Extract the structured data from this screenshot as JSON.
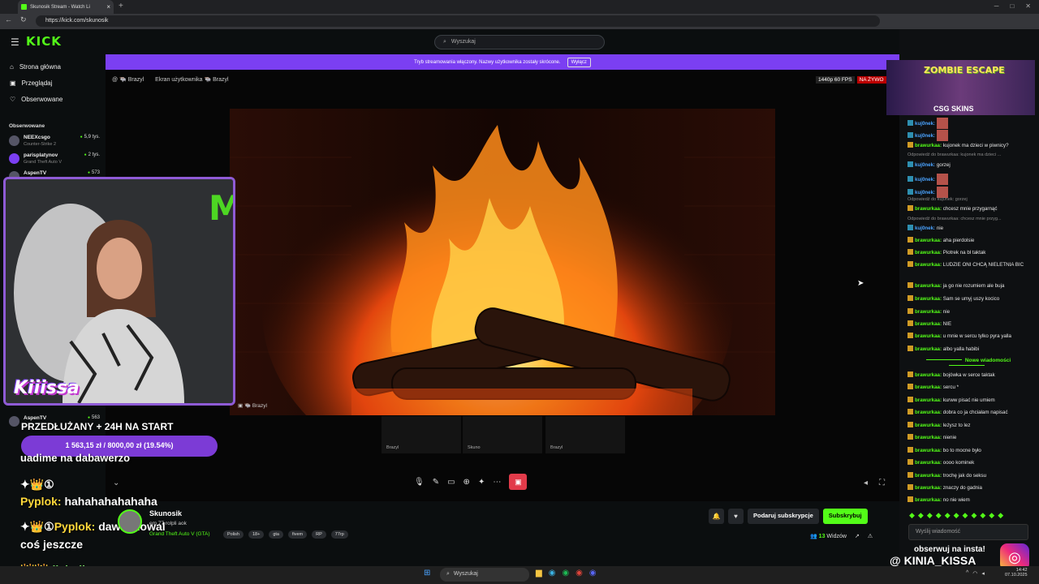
{
  "browser": {
    "tab_title": "Skunosik Stream - Watch Li",
    "url": "https://kick.com/skunosik"
  },
  "header": {
    "logo": "KICK",
    "search_placeholder": "Wyszukaj"
  },
  "sidebar": {
    "nav": [
      {
        "label": "Strona główna",
        "icon": "home-icon"
      },
      {
        "label": "Przeglądaj",
        "icon": "browse-icon"
      },
      {
        "label": "Obserwowane",
        "icon": "heart-icon"
      }
    ],
    "followed_header": "Obserwowane",
    "followed": [
      {
        "name": "NEEXcsgo",
        "game": "Counter-Strike 2",
        "viewers": "5,9 tys."
      },
      {
        "name": "parisplatynov",
        "game": "Grand Theft Auto V",
        "viewers": "2 tys."
      },
      {
        "name": "AspenTV",
        "game": "",
        "viewers": "573"
      },
      {
        "name": "AspenTV",
        "game": "",
        "viewers": "563"
      }
    ]
  },
  "banner": {
    "text": "Tryb streamowania włączony. Nazwy użytkownika zostały skrócone.",
    "button": "Wyłącz"
  },
  "player": {
    "source1": "Brazyl",
    "source2": "Ekran użytkownika",
    "source2_user": "Brazyl",
    "quality": "1440p 60 FPS",
    "live": "NA ŻYWO",
    "overlay_label": "Brazyl",
    "thumbs": [
      "Brazyl",
      "Skuno",
      "Brazyl"
    ]
  },
  "stream_overlay": {
    "goal_title": "PRZEDŁUŻANY + 24H NA START",
    "goal_amount": "1 563,15 zł / 8000,00 zł (19.54%)",
    "goal_progress": 0.1954,
    "cam_name": "Kiiissa",
    "chat_lines": [
      {
        "user": "",
        "text": "uadime na dabawerzo"
      },
      {
        "user": "Pyplok:",
        "text": "hahahahahahaha"
      },
      {
        "user": "Pyplok:",
        "text": "dawaj dowal"
      },
      {
        "user": "",
        "text": "coś jeszcze"
      },
      {
        "user": "diabolinanana:",
        "text": ""
      }
    ]
  },
  "channel": {
    "name": "Skunosik",
    "title": "em 77 rolpli aok",
    "game": "Grand Theft Auto V (GTA)",
    "tags": [
      "Polish",
      "18+",
      "gta",
      "fivem",
      "RP",
      "77rp"
    ],
    "gift_sub": "Podaruj subskrypcje",
    "subscribe": "Subskrybuj",
    "viewers_count": "13",
    "viewers_label": "Widzów"
  },
  "chat": {
    "ad_title": "ZOMBIE ESCAPE",
    "ad_brand": "CSG SKINS",
    "new_messages": "Nowe wiadomości",
    "input_placeholder": "Wyślij wiadomość",
    "messages": [
      {
        "user": "kuj0nek:",
        "text": "",
        "emote": true,
        "badge": "blue"
      },
      {
        "user": "kuj0nek:",
        "text": "",
        "emote": true,
        "badge": "blue"
      },
      {
        "user": "brawurkaa:",
        "text": "kujonek ma dzieci w piwnicy?",
        "badge": "gold"
      },
      {
        "reply": "Odpowiedź do brawurkaa: kujonek ma dzieci ..."
      },
      {
        "user": "kuj0nek:",
        "text": "gorzej",
        "badge": "blue"
      },
      {
        "user": "kuj0nek:",
        "text": "",
        "emote": true,
        "badge": "blue"
      },
      {
        "user": "kuj0nek:",
        "text": "",
        "emote": true,
        "badge": "blue"
      },
      {
        "reply": "Odpowiedź do kuj0nek: gorzej"
      },
      {
        "user": "brawurkaa:",
        "text": "chcesz mnie przygarnąć",
        "badge": "gold"
      },
      {
        "reply": "Odpowiedź do brawurkaa: chcesz mnie przyg..."
      },
      {
        "user": "kuj0nek:",
        "text": "nie",
        "badge": "blue"
      },
      {
        "user": "brawurkaa:",
        "text": "aha pierdolsie",
        "badge": "gold"
      },
      {
        "user": "brawurkaa:",
        "text": "Piotrek na bl taktak",
        "badge": "gold"
      },
      {
        "user": "brawurkaa:",
        "text": "LUDZIE ONI CHCĄ NIELETNIA BIC",
        "badge": "gold"
      },
      {
        "user": "brawurkaa:",
        "text": "ja go nie rozumiem ale buja",
        "badge": "gold"
      },
      {
        "user": "brawurkaa:",
        "text": "Sam se umyj uszy kocico",
        "badge": "gold"
      },
      {
        "user": "brawurkaa:",
        "text": "nie",
        "badge": "gold"
      },
      {
        "user": "brawurkaa:",
        "text": "NIE",
        "badge": "gold"
      },
      {
        "user": "brawurkaa:",
        "text": "u mnie w sercu tylko pyra yalla",
        "badge": "gold"
      },
      {
        "user": "brawurkaa:",
        "text": "albo yalla habibi",
        "badge": "gold"
      },
      {
        "user": "brawurkaa:",
        "text": "bojówka w serce taktak",
        "badge": "gold"
      },
      {
        "user": "brawurkaa:",
        "text": "sercu *",
        "badge": "gold"
      },
      {
        "user": "brawurkaa:",
        "text": "kurww pisać nie umiem",
        "badge": "gold"
      },
      {
        "user": "brawurkaa:",
        "text": "dobra co ja chciałam napisać",
        "badge": "gold"
      },
      {
        "user": "brawurkaa:",
        "text": "leżysz to lez",
        "badge": "gold"
      },
      {
        "user": "brawurkaa:",
        "text": "nienie",
        "badge": "gold"
      },
      {
        "user": "brawurkaa:",
        "text": "bo to mocne było",
        "badge": "gold"
      },
      {
        "user": "brawurkaa:",
        "text": "oooo kominek",
        "badge": "gold"
      },
      {
        "user": "brawurkaa:",
        "text": "trochę jak do seksu",
        "badge": "gold"
      },
      {
        "user": "brawurkaa:",
        "text": "znaczy do gadnia",
        "badge": "gold"
      },
      {
        "user": "brawurkaa:",
        "text": "no nie wiem",
        "badge": "gold"
      }
    ],
    "insta_cta": "obserwuj na insta!",
    "insta_handle": "KINIA_KISSA"
  },
  "taskbar": {
    "search": "Wyszukaj",
    "time": "14:42",
    "date": "07.10.2025"
  },
  "colors": {
    "kick_green": "#53fc18",
    "banner_purple": "#7b3ff2",
    "goal_purple": "#7c3bd6"
  }
}
